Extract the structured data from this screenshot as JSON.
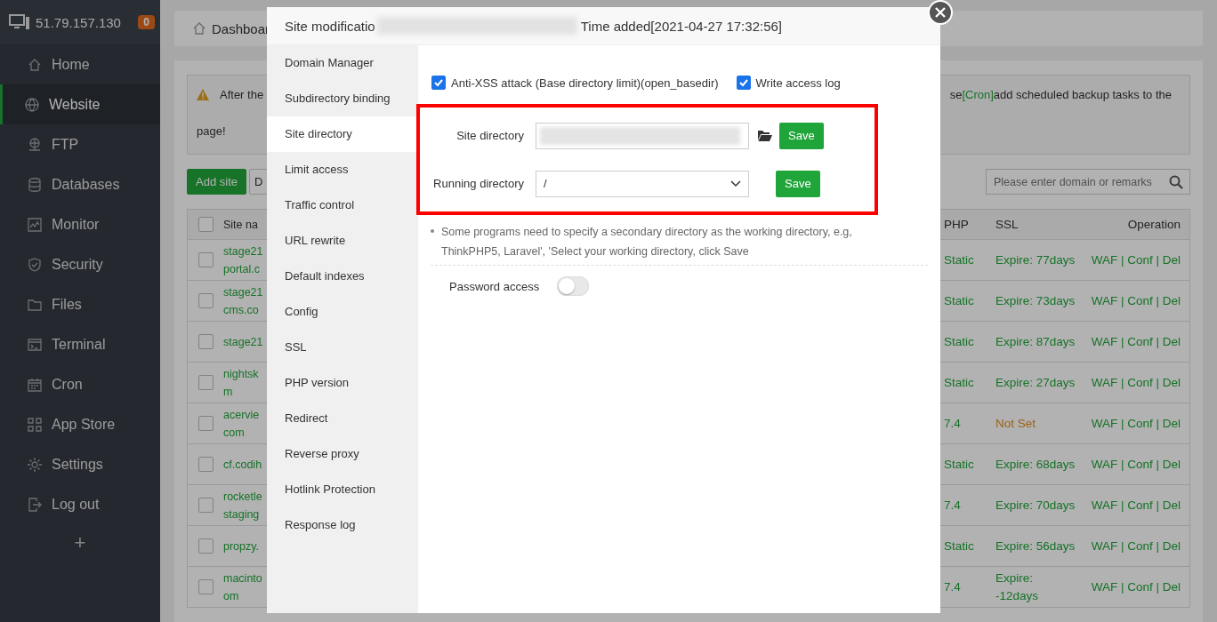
{
  "sidebar": {
    "server_ip": "51.79.157.130",
    "badge": "0",
    "items": [
      {
        "label": "Home",
        "selected": false
      },
      {
        "label": "Website",
        "selected": true
      },
      {
        "label": "FTP",
        "selected": false
      },
      {
        "label": "Databases",
        "selected": false
      },
      {
        "label": "Monitor",
        "selected": false
      },
      {
        "label": "Security",
        "selected": false
      },
      {
        "label": "Files",
        "selected": false
      },
      {
        "label": "Terminal",
        "selected": false
      },
      {
        "label": "Cron",
        "selected": false
      },
      {
        "label": "App Store",
        "selected": false
      },
      {
        "label": "Settings",
        "selected": false
      },
      {
        "label": "Log out",
        "selected": false
      }
    ],
    "add_label": "+"
  },
  "breadcrumb": {
    "label": "Dashboar"
  },
  "alert": {
    "text_left": "After the",
    "text_right": "se",
    "link": "[Cron]",
    "text_right_after": "add scheduled backup tasks to the",
    "text_line2": "page!"
  },
  "toolbar": {
    "buttons": [
      {
        "label": "Add site",
        "kind": "primary"
      },
      {
        "label": "D",
        "kind": "default"
      }
    ],
    "search": {
      "placeholder": "Please enter domain or remarks"
    }
  },
  "table": {
    "all_checked": false,
    "columns": [
      "Site na",
      "PHP",
      "SSL",
      "Operation"
    ],
    "rows": [
      {
        "checked": false,
        "site": "stage21\nportal.c",
        "php": "Static",
        "ssl": "Expire: 77days",
        "ssl_set": true,
        "operation": "WAF | Conf | Del"
      },
      {
        "checked": false,
        "site": "stage21\ncms.co",
        "php": "Static",
        "ssl": "Expire: 73days",
        "ssl_set": true,
        "operation": "WAF | Conf | Del"
      },
      {
        "checked": false,
        "site": "stage21",
        "php": "Static",
        "ssl": "Expire: 87days",
        "ssl_set": true,
        "operation": "WAF | Conf | Del"
      },
      {
        "checked": false,
        "site": "nightsk\nm",
        "php": "Static",
        "ssl": "Expire: 27days",
        "ssl_set": true,
        "operation": "WAF | Conf | Del"
      },
      {
        "checked": false,
        "site": "acervie\ncom",
        "php": "7.4",
        "ssl": "Not Set",
        "ssl_set": false,
        "operation": "WAF | Conf | Del"
      },
      {
        "checked": false,
        "site": "cf.codih",
        "php": "Static",
        "ssl": "Expire: 68days",
        "ssl_set": true,
        "operation": "WAF | Conf | Del"
      },
      {
        "checked": false,
        "site": "rocketle\nstaging",
        "php": "7.4",
        "ssl": "Expire: 70days",
        "ssl_set": true,
        "operation": "WAF | Conf | Del"
      },
      {
        "checked": false,
        "site": "propzy.",
        "php": "Static",
        "ssl": "Expire: 56days",
        "ssl_set": true,
        "operation": "WAF | Conf | Del"
      },
      {
        "checked": false,
        "site": "macinto\nom",
        "php": "7.4",
        "ssl": "Expire:\n-12days",
        "ssl_set": true,
        "operation": "WAF | Conf | Del"
      }
    ]
  },
  "modal": {
    "title": "Site modificatio",
    "time_added": "Time added[2021-04-27 17:32:56]",
    "nav": [
      {
        "label": "Domain Manager",
        "selected": false
      },
      {
        "label": "Subdirectory binding",
        "selected": false
      },
      {
        "label": "Site directory",
        "selected": true
      },
      {
        "label": "Limit access",
        "selected": false
      },
      {
        "label": "Traffic control",
        "selected": false
      },
      {
        "label": "URL rewrite",
        "selected": false
      },
      {
        "label": "Default indexes",
        "selected": false
      },
      {
        "label": "Config",
        "selected": false
      },
      {
        "label": "SSL",
        "selected": false
      },
      {
        "label": "PHP version",
        "selected": false
      },
      {
        "label": "Redirect",
        "selected": false
      },
      {
        "label": "Reverse proxy",
        "selected": false
      },
      {
        "label": "Hotlink Protection",
        "selected": false
      },
      {
        "label": "Response log",
        "selected": false
      }
    ],
    "options": [
      {
        "label": "Anti-XSS attack (Base directory limit)(open_basedir)",
        "checked": true
      },
      {
        "label": "Write access log",
        "checked": true
      }
    ],
    "site_directory": {
      "label": "Site directory",
      "button": "Save"
    },
    "running_directory": {
      "label": "Running directory",
      "value": "/",
      "button": "Save"
    },
    "hint": "Some programs need to specify a secondary directory as the working directory, e.g, ThinkPHP5, Laravel', 'Select your working directory, click Save",
    "password_access": {
      "label": "Password access",
      "on": false
    }
  }
}
